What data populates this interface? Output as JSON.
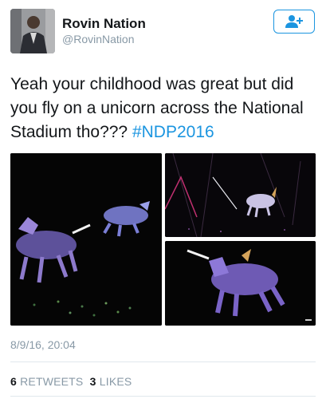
{
  "user": {
    "display_name": "Rovin Nation",
    "handle": "@RovinNation",
    "avatar_icon": "person-avatar"
  },
  "follow_button": {
    "icon": "add-user-icon",
    "color": "#1b95e0"
  },
  "tweet": {
    "text": "Yeah your childhood was great but did you fly on a unicorn across the National Stadium tho???",
    "hashtag": "#NDP2016",
    "timestamp": "8/9/16, 20:04"
  },
  "media": [
    {
      "description": "unicorn-photo-1"
    },
    {
      "description": "unicorn-photo-2"
    },
    {
      "description": "unicorn-photo-3"
    }
  ],
  "stats": {
    "retweets_count": "6",
    "retweets_label": "RETWEETS",
    "likes_count": "3",
    "likes_label": "LIKES"
  },
  "colors": {
    "accent": "#1b95e0",
    "secondary_text": "#8899a6",
    "primary_text": "#14171a"
  }
}
